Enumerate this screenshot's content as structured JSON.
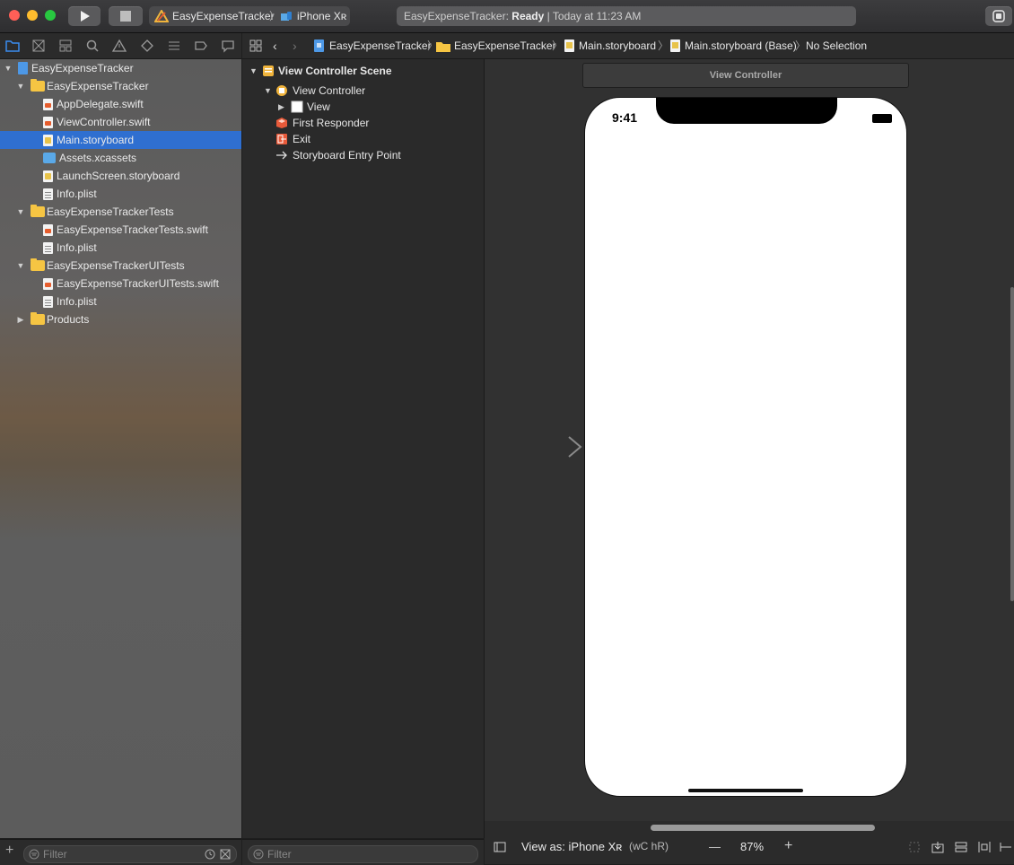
{
  "toolbar": {
    "scheme": "EasyExpenseTracker",
    "device": "iPhone Xʀ",
    "status_app": "EasyExpenseTracker: ",
    "status_state": "Ready",
    "status_sep": " | ",
    "status_time": "Today at 11:23 AM"
  },
  "navigator": {
    "items": [
      {
        "label": "EasyExpenseTracker",
        "level": 0,
        "kind": "project",
        "disclosure": "open"
      },
      {
        "label": "EasyExpenseTracker",
        "level": 1,
        "kind": "folder",
        "disclosure": "open"
      },
      {
        "label": "AppDelegate.swift",
        "level": 2,
        "kind": "swift"
      },
      {
        "label": "ViewController.swift",
        "level": 2,
        "kind": "swift"
      },
      {
        "label": "Main.storyboard",
        "level": 2,
        "kind": "sb",
        "selected": true
      },
      {
        "label": "Assets.xcassets",
        "level": 2,
        "kind": "assets"
      },
      {
        "label": "LaunchScreen.storyboard",
        "level": 2,
        "kind": "sb"
      },
      {
        "label": "Info.plist",
        "level": 2,
        "kind": "plist"
      },
      {
        "label": "EasyExpenseTrackerTests",
        "level": 1,
        "kind": "folder",
        "disclosure": "open"
      },
      {
        "label": "EasyExpenseTrackerTests.swift",
        "level": 2,
        "kind": "swift"
      },
      {
        "label": "Info.plist",
        "level": 2,
        "kind": "plist"
      },
      {
        "label": "EasyExpenseTrackerUITests",
        "level": 1,
        "kind": "folder",
        "disclosure": "open"
      },
      {
        "label": "EasyExpenseTrackerUITests.swift",
        "level": 2,
        "kind": "swift"
      },
      {
        "label": "Info.plist",
        "level": 2,
        "kind": "plist"
      },
      {
        "label": "Products",
        "level": 1,
        "kind": "folder",
        "disclosure": "closed"
      }
    ],
    "filter_placeholder": "Filter"
  },
  "jumpbar": {
    "crumbs": [
      "EasyExpenseTracker",
      "EasyExpenseTracker",
      "Main.storyboard",
      "Main.storyboard (Base)",
      "No Selection"
    ]
  },
  "outline": {
    "scene": "View Controller Scene",
    "view_controller": "View Controller",
    "view": "View",
    "first_responder": "First Responder",
    "exit": "Exit",
    "entry_point": "Storyboard Entry Point",
    "filter_placeholder": "Filter"
  },
  "canvas": {
    "scene_title": "View Controller",
    "status_time": "9:41"
  },
  "bottom": {
    "view_as": "View as: iPhone Xʀ",
    "size_class": "(wC hR)",
    "zoom_out": "—",
    "zoom": "87%",
    "zoom_in": "+"
  },
  "colors": {
    "selection": "#2f6fd0",
    "close": "#ff5f57",
    "minimize": "#febc2e",
    "zoom": "#28c840"
  }
}
